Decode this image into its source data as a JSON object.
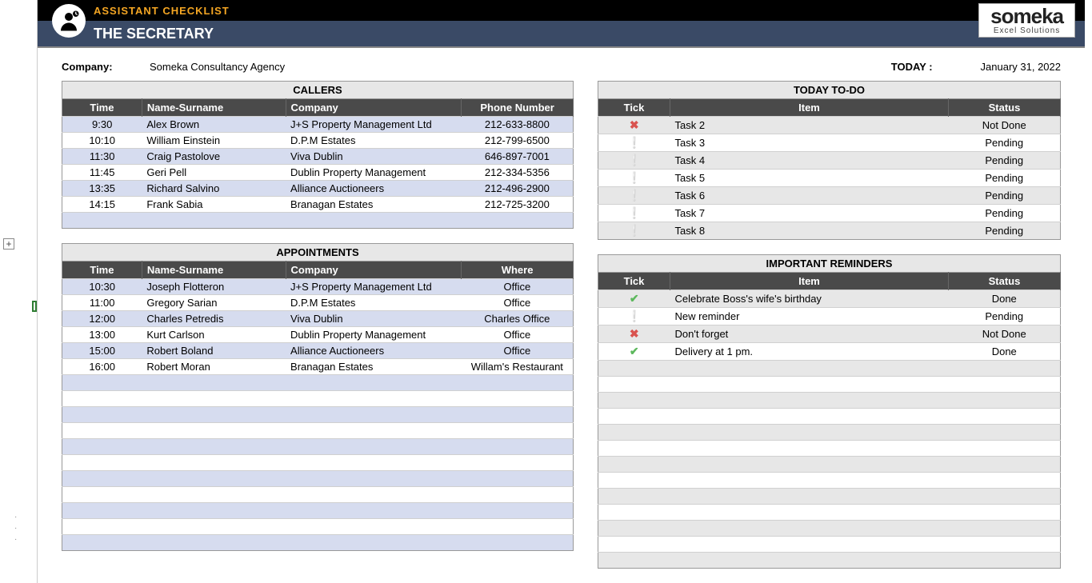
{
  "header": {
    "small_title": "ASSISTANT CHECKLIST",
    "main_title": "THE SECRETARY",
    "logo_line1": "someka",
    "logo_line2": "Excel Solutions"
  },
  "meta": {
    "company_label": "Company:",
    "company_value": "Someka Consultancy Agency",
    "today_label": "TODAY :",
    "today_value": "January 31, 2022"
  },
  "callers": {
    "title": "CALLERS",
    "cols": [
      "Time",
      "Name-Surname",
      "Company",
      "Phone Number"
    ],
    "rows": [
      {
        "time": "9:30",
        "name": "Alex Brown",
        "company": "J+S Property Management Ltd",
        "phone": "212-633-8800"
      },
      {
        "time": "10:10",
        "name": "William Einstein",
        "company": "D.P.M Estates",
        "phone": "212-799-6500"
      },
      {
        "time": "11:30",
        "name": "Craig Pastolove",
        "company": "Viva Dublin",
        "phone": "646-897-7001"
      },
      {
        "time": "11:45",
        "name": "Geri Pell",
        "company": "Dublin Property Management",
        "phone": "212-334-5356"
      },
      {
        "time": "13:35",
        "name": "Richard Salvino",
        "company": "Alliance Auctioneers",
        "phone": "212-496-2900"
      },
      {
        "time": "14:15",
        "name": "Frank Sabia",
        "company": "Branagan Estates",
        "phone": "212-725-3200"
      }
    ],
    "blank_rows": 1
  },
  "appointments": {
    "title": "APPOINTMENTS",
    "cols": [
      "Time",
      "Name-Surname",
      "Company",
      "Where"
    ],
    "rows": [
      {
        "time": "10:30",
        "name": "Joseph Flotteron",
        "company": "J+S Property Management Ltd",
        "where": "Office"
      },
      {
        "time": "11:00",
        "name": "Gregory Sarian",
        "company": "D.P.M Estates",
        "where": "Office"
      },
      {
        "time": "12:00",
        "name": "Charles Petredis",
        "company": "Viva Dublin",
        "where": "Charles Office"
      },
      {
        "time": "13:00",
        "name": "Kurt Carlson",
        "company": "Dublin Property Management",
        "where": "Office"
      },
      {
        "time": "15:00",
        "name": "Robert Boland",
        "company": "Alliance Auctioneers",
        "where": "Office"
      },
      {
        "time": "16:00",
        "name": "Robert Moran",
        "company": "Branagan Estates",
        "where": "Willam's Restaurant"
      }
    ],
    "blank_rows": 11
  },
  "todo": {
    "title": "TODAY TO-DO",
    "cols": [
      "Tick",
      "Item",
      "Status"
    ],
    "rows": [
      {
        "tick": "cross",
        "item": "Task 2",
        "status": "Not Done"
      },
      {
        "tick": "excl",
        "item": "Task 3",
        "status": "Pending"
      },
      {
        "tick": "excl",
        "item": "Task 4",
        "status": "Pending"
      },
      {
        "tick": "excl",
        "item": "Task 5",
        "status": "Pending"
      },
      {
        "tick": "excl",
        "item": "Task 6",
        "status": "Pending"
      },
      {
        "tick": "excl",
        "item": "Task 7",
        "status": "Pending"
      },
      {
        "tick": "excl",
        "item": "Task 8",
        "status": "Pending"
      }
    ],
    "blank_rows": 0
  },
  "reminders": {
    "title": "IMPORTANT REMINDERS",
    "cols": [
      "Tick",
      "Item",
      "Status"
    ],
    "rows": [
      {
        "tick": "check",
        "item": "Celebrate Boss's wife's birthday",
        "status": "Done"
      },
      {
        "tick": "excl",
        "item": "New reminder",
        "status": "Pending"
      },
      {
        "tick": "cross",
        "item": "Don't forget",
        "status": "Not Done"
      },
      {
        "tick": "check",
        "item": "Delivery at 1 pm.",
        "status": "Done"
      }
    ],
    "blank_rows": 13
  },
  "icons": {
    "cross": "✖",
    "excl": "❕",
    "check": "✔"
  }
}
